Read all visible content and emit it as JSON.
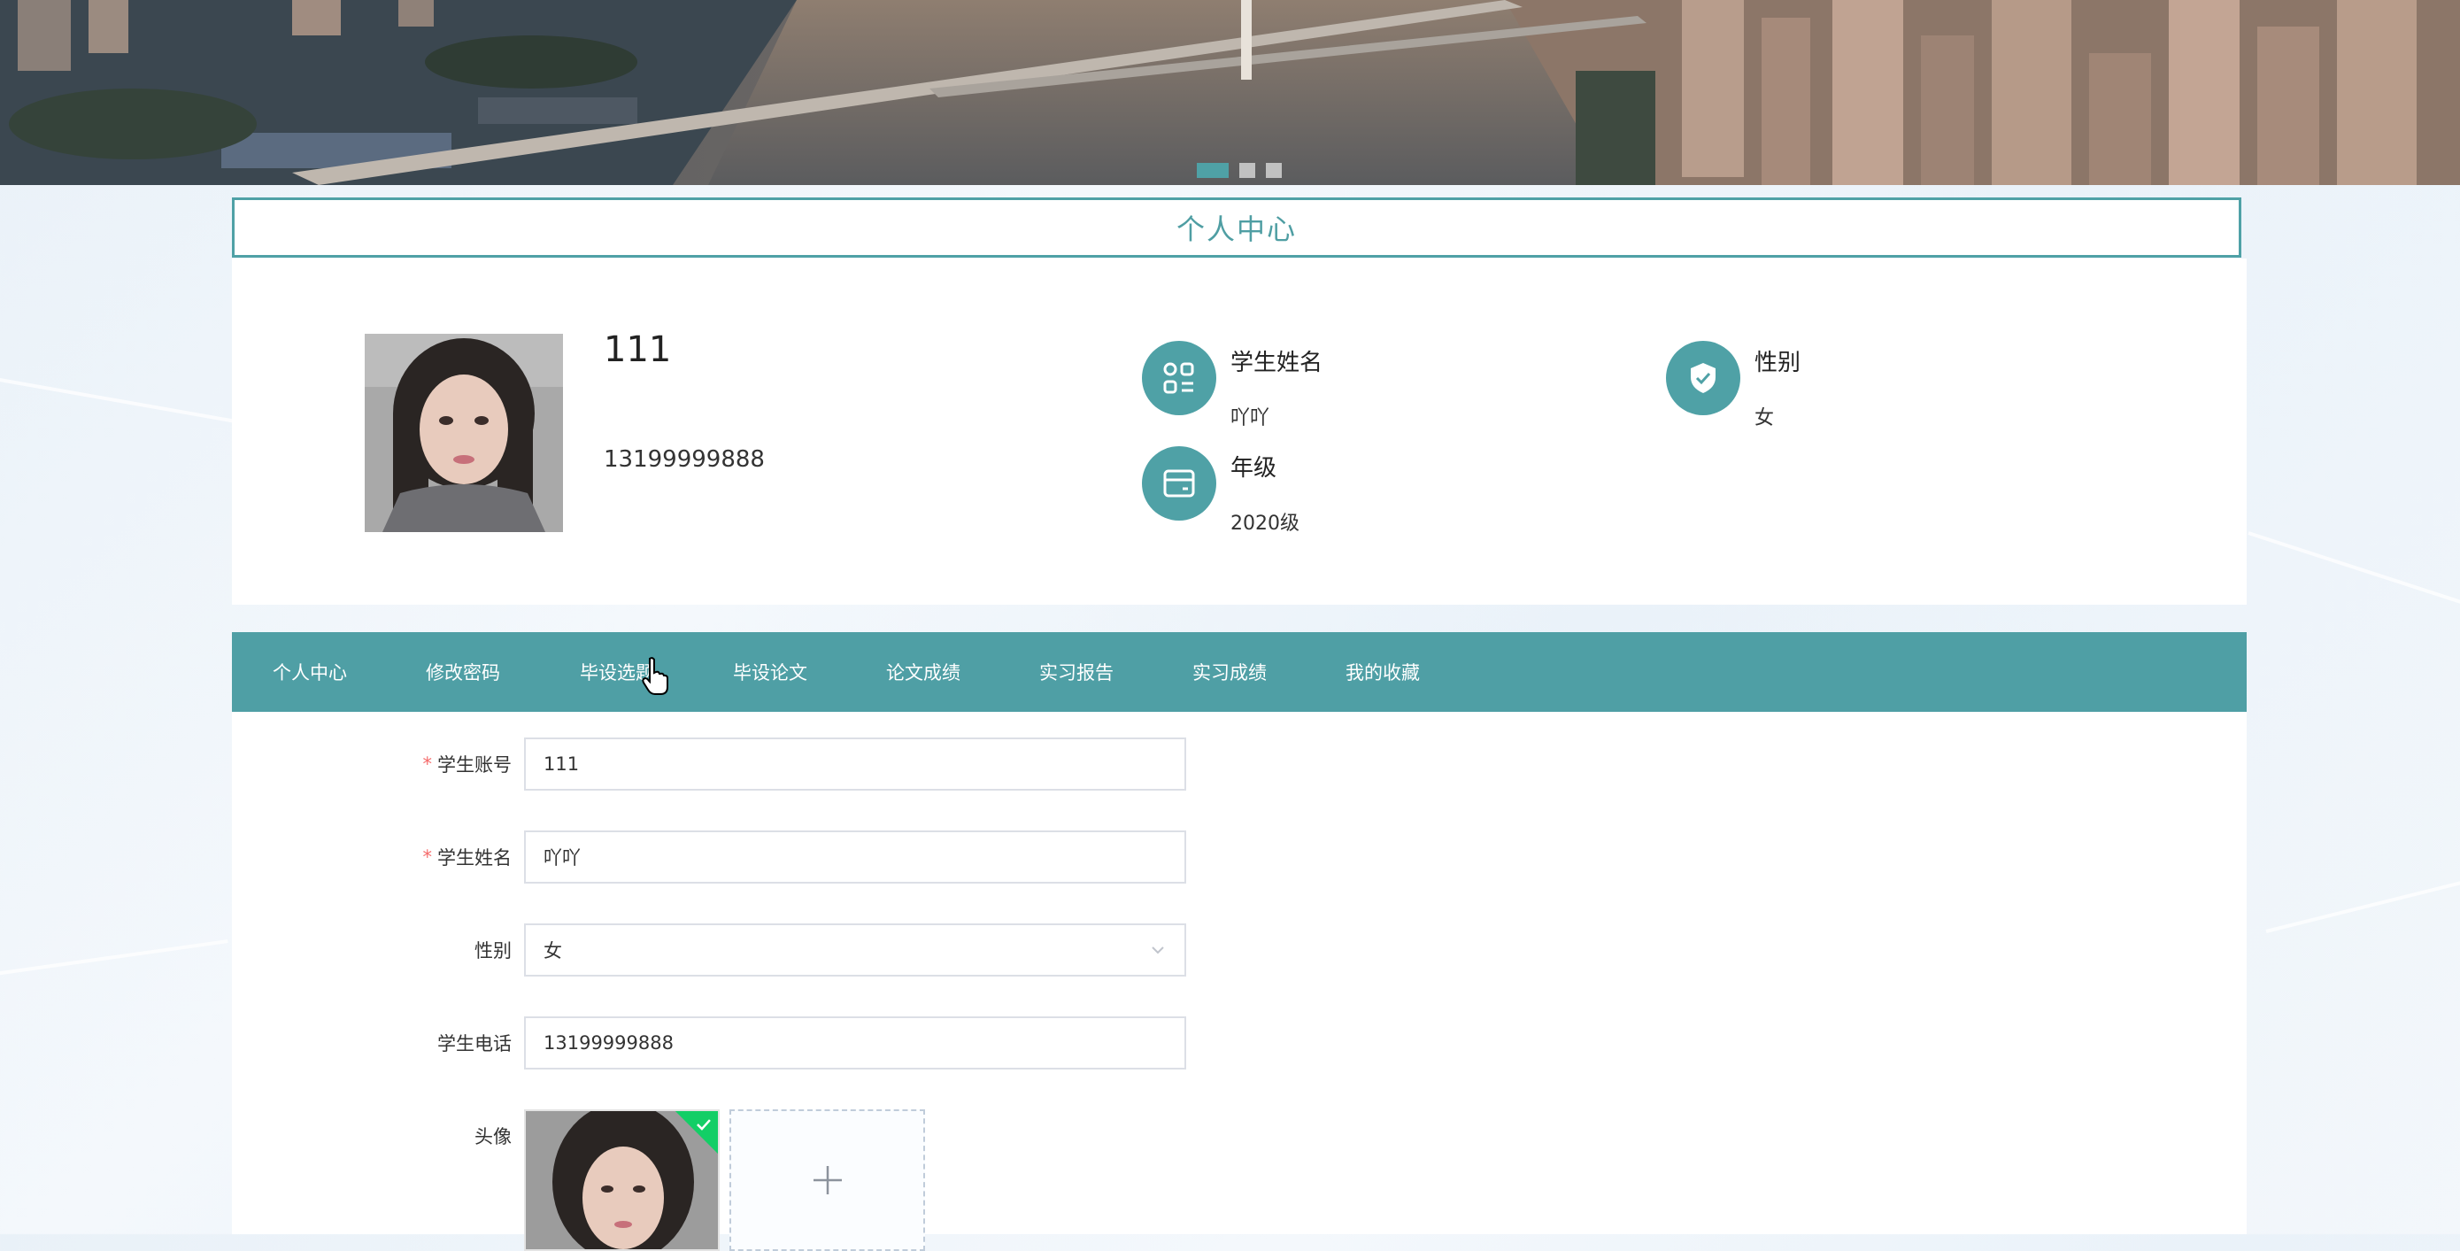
{
  "colors": {
    "accent": "#4fa1a6",
    "tab_bg": "#4f9fa5",
    "required": "#f56c6c",
    "upload_success": "#13ce66"
  },
  "banner": {
    "dots": [
      "slide-1",
      "slide-2",
      "slide-3"
    ],
    "active_dot": 0
  },
  "page_title": "个人中心",
  "profile": {
    "username": "111",
    "phone": "13199999888",
    "fields": [
      {
        "label": "学生姓名",
        "value": "吖吖",
        "icon": "apps-icon"
      },
      {
        "label": "性别",
        "value": "女",
        "icon": "shield-check-icon"
      },
      {
        "label": "年级",
        "value": "2020级",
        "icon": "wallet-card-icon"
      }
    ]
  },
  "tabs": [
    {
      "label": "个人中心",
      "active": true
    },
    {
      "label": "修改密码"
    },
    {
      "label": "毕设选题"
    },
    {
      "label": "毕设论文"
    },
    {
      "label": "论文成绩"
    },
    {
      "label": "实习报告"
    },
    {
      "label": "实习成绩"
    },
    {
      "label": "我的收藏"
    }
  ],
  "form": {
    "account": {
      "label": "学生账号",
      "value": "111",
      "required": true
    },
    "name": {
      "label": "学生姓名",
      "value": "吖吖",
      "required": true
    },
    "gender": {
      "label": "性别",
      "value": "女"
    },
    "phone": {
      "label": "学生电话",
      "value": "13199999888"
    },
    "avatar": {
      "label": "头像"
    }
  }
}
